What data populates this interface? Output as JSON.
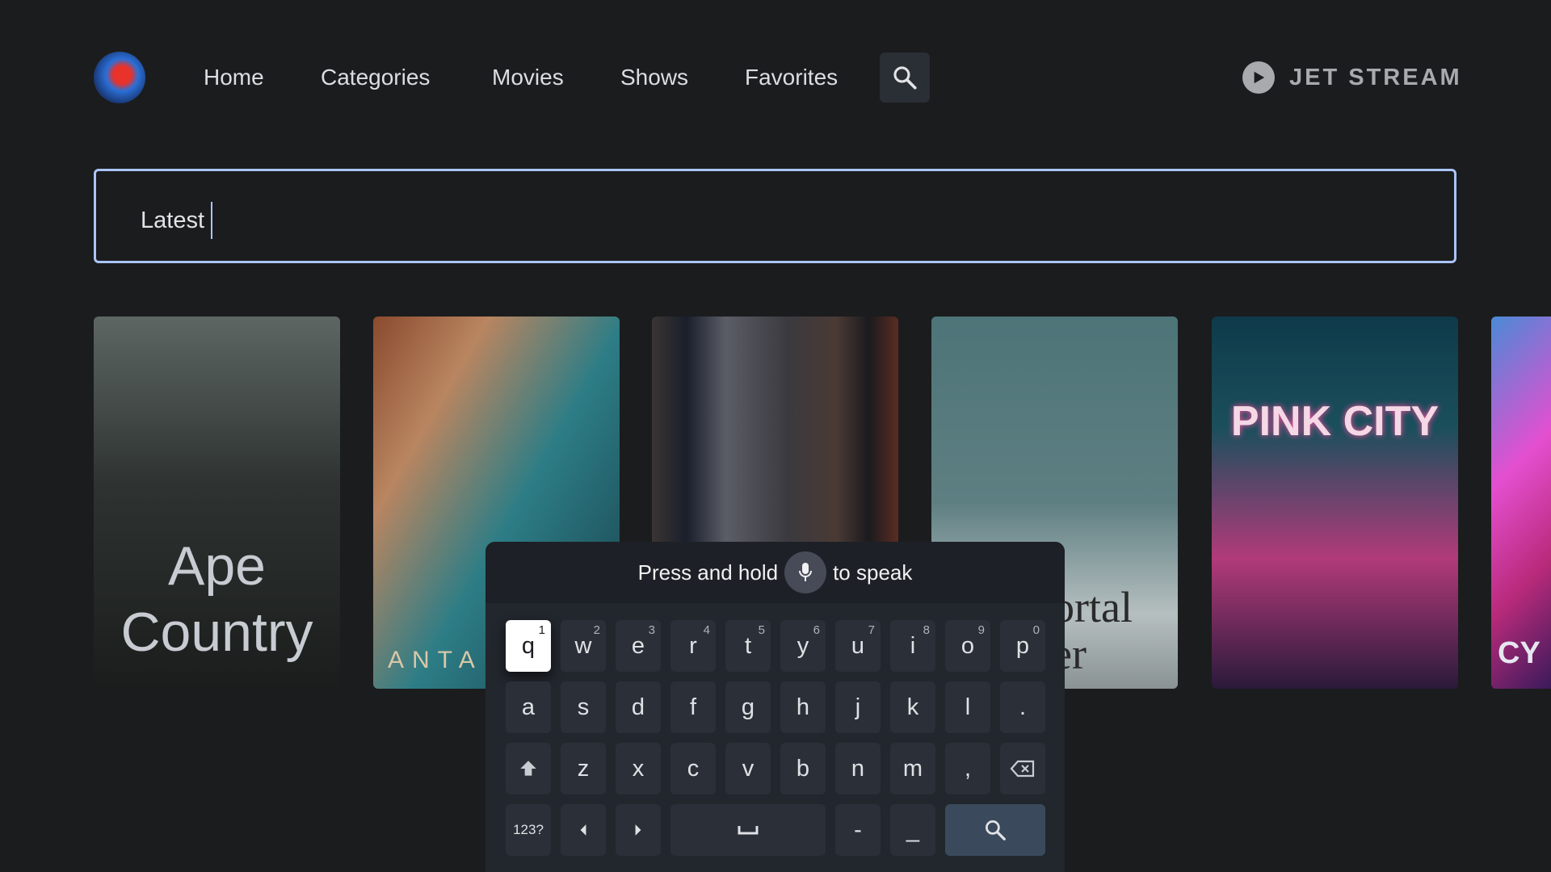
{
  "nav": {
    "items": [
      {
        "label": "Home"
      },
      {
        "label": "Categories"
      },
      {
        "label": "Movies"
      },
      {
        "label": "Shows"
      },
      {
        "label": "Favorites"
      }
    ],
    "search_icon": "search-icon",
    "avatar_icon": "avatar"
  },
  "brand": {
    "name": "JET STREAM",
    "icon": "play-circle-icon"
  },
  "search": {
    "value": "Latest"
  },
  "posters": [
    {
      "title": "Ape Country"
    },
    {
      "title": "ANTA"
    },
    {
      "title": ""
    },
    {
      "title": "ortal er"
    },
    {
      "title": "PINK CITY"
    },
    {
      "title": "CY"
    }
  ],
  "keyboard": {
    "hint_before": "Press and hold",
    "hint_after": "to speak",
    "mic_icon": "microphone-icon",
    "rows": [
      [
        {
          "k": "q",
          "s": "1"
        },
        {
          "k": "w",
          "s": "2"
        },
        {
          "k": "e",
          "s": "3"
        },
        {
          "k": "r",
          "s": "4"
        },
        {
          "k": "t",
          "s": "5"
        },
        {
          "k": "y",
          "s": "6"
        },
        {
          "k": "u",
          "s": "7"
        },
        {
          "k": "i",
          "s": "8"
        },
        {
          "k": "o",
          "s": "9"
        },
        {
          "k": "p",
          "s": "0"
        }
      ],
      [
        {
          "k": "a"
        },
        {
          "k": "s"
        },
        {
          "k": "d"
        },
        {
          "k": "f"
        },
        {
          "k": "g"
        },
        {
          "k": "h"
        },
        {
          "k": "j"
        },
        {
          "k": "k"
        },
        {
          "k": "l"
        },
        {
          "k": "."
        }
      ],
      [
        {
          "icon": "shift-icon"
        },
        {
          "k": "z"
        },
        {
          "k": "x"
        },
        {
          "k": "c"
        },
        {
          "k": "v"
        },
        {
          "k": "b"
        },
        {
          "k": "n"
        },
        {
          "k": "m"
        },
        {
          "k": ","
        },
        {
          "icon": "backspace-icon"
        }
      ],
      [
        {
          "k": "123?"
        },
        {
          "icon": "arrow-left-icon"
        },
        {
          "icon": "arrow-right-icon"
        },
        {
          "icon": "space-icon",
          "span": 3
        },
        {
          "k": "-"
        },
        {
          "k": "_"
        },
        {
          "icon": "search-icon",
          "span": 2
        }
      ]
    ],
    "focused_key": "q",
    "colors": {
      "focus": "#ffffff",
      "key": "#2b3038",
      "search_key": "#3a4a5c"
    }
  },
  "colors": {
    "background": "#1b1c1e",
    "focus_border": "#aac4f7"
  }
}
